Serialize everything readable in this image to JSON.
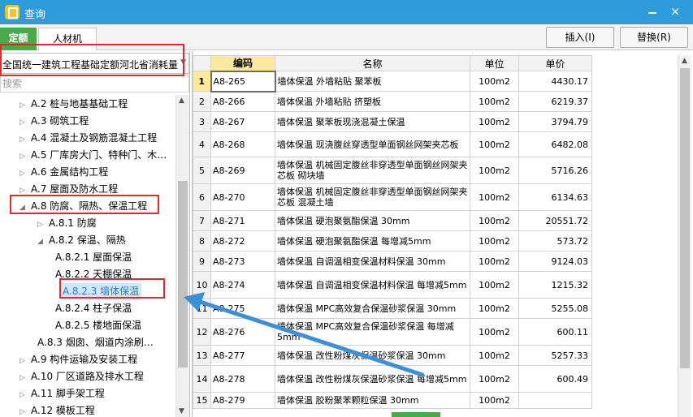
{
  "window": {
    "title": "查询",
    "minimize_glyph": "",
    "close_glyph": "×"
  },
  "tabs": [
    {
      "label": "定额",
      "active": true
    },
    {
      "label": "人材机",
      "active": false
    }
  ],
  "actions": {
    "insert_label": "插入(I)",
    "replace_label": "替换(R)"
  },
  "left": {
    "quota_library": "全国统一建筑工程基础定额河北省消耗量",
    "search_placeholder": "搜索",
    "tree": [
      {
        "label": "A.2 桩与地基基础工程",
        "toggle": "▷"
      },
      {
        "label": "A.3 砌筑工程",
        "toggle": "▷"
      },
      {
        "label": "A.4 混凝土及钢筋混凝土工程",
        "toggle": "▷"
      },
      {
        "label": "A.5 厂库房大门、特种门、木…",
        "toggle": "▷"
      },
      {
        "label": "A.6 金属结构工程",
        "toggle": "▷"
      },
      {
        "label": "A.7 屋面及防水工程",
        "toggle": "▷"
      },
      {
        "label": "A.8 防腐、隔热、保温工程",
        "toggle": "◢"
      },
      {
        "label": "A.8.1 防腐",
        "toggle": "▷"
      },
      {
        "label": "A.8.2 保温、隔热",
        "toggle": "◢"
      },
      {
        "label": "A.8.2.1 屋面保温",
        "toggle": ""
      },
      {
        "label": "A.8.2.2 天棚保温",
        "toggle": ""
      },
      {
        "label": "A.8.2.3 墙体保温",
        "toggle": "",
        "selected": true
      },
      {
        "label": "A.8.2.4 柱子保温",
        "toggle": ""
      },
      {
        "label": "A.8.2.5 楼地面保温",
        "toggle": ""
      },
      {
        "label": "A.8.3 烟囱、烟道内涂刷…",
        "toggle": ""
      },
      {
        "label": "A.9 构件运输及安装工程",
        "toggle": "▷"
      },
      {
        "label": "A.10 厂区道路及排水工程",
        "toggle": "▷"
      },
      {
        "label": "A.11 脚手架工程",
        "toggle": "▷"
      },
      {
        "label": "A.12 模板工程",
        "toggle": "▷"
      }
    ]
  },
  "table": {
    "headers": {
      "num": "",
      "code": "编码",
      "name": "名称",
      "unit": "单位",
      "price": "单价"
    },
    "rows": [
      {
        "num": "1",
        "code": "A8-265",
        "name": "墙体保温 外墙粘贴 聚苯板",
        "unit": "100m2",
        "price": "4430.17"
      },
      {
        "num": "2",
        "code": "A8-266",
        "name": "墙体保温 外墙粘贴 挤塑板",
        "unit": "100m2",
        "price": "6219.37"
      },
      {
        "num": "3",
        "code": "A8-267",
        "name": "墙体保温 聚苯板现浇混凝土保温",
        "unit": "100m2",
        "price": "3794.79"
      },
      {
        "num": "4",
        "code": "A8-268",
        "name": "墙体保温 现浇腹丝穿透型单面钢丝网架夹芯板",
        "unit": "100m2",
        "price": "6482.08"
      },
      {
        "num": "5",
        "code": "A8-269",
        "name": "墙体保温 机械固定腹丝非穿透型单面钢丝网架夹芯板 砌块墙",
        "unit": "100m2",
        "price": "5716.26"
      },
      {
        "num": "6",
        "code": "A8-270",
        "name": "墙体保温 机械固定腹丝非穿透型单面钢丝网架夹芯板 混凝土墙",
        "unit": "100m2",
        "price": "6134.63"
      },
      {
        "num": "7",
        "code": "A8-271",
        "name": "墙体保温 硬泡聚氨酯保温 30mm",
        "unit": "100m2",
        "price": "20551.72"
      },
      {
        "num": "8",
        "code": "A8-272",
        "name": "墙体保温 硬泡聚氨酯保温 每增减5mm",
        "unit": "100m2",
        "price": "573.72"
      },
      {
        "num": "9",
        "code": "A8-273",
        "name": "墙体保温 自调温相变保温材料保温 30mm",
        "unit": "100m2",
        "price": "9124.03"
      },
      {
        "num": "10",
        "code": "A8-274",
        "name": "墙体保温 自调温相变保温材料保温 每增减5mm",
        "unit": "100m2",
        "price": "1215.32"
      },
      {
        "num": "11",
        "code": "A8-275",
        "name": "墙体保温 MPC高效复合保温砂浆保温 30mm",
        "unit": "100m2",
        "price": "5255.08"
      },
      {
        "num": "12",
        "code": "A8-276",
        "name": "墙体保温 MPC高效复合保温砂浆保温 每增减5mm",
        "unit": "100m2",
        "price": "600.11"
      },
      {
        "num": "13",
        "code": "A8-277",
        "name": "墙体保温 改性粉煤灰保温砂浆保温 30mm",
        "unit": "100m2",
        "price": "5257.33"
      },
      {
        "num": "14",
        "code": "A8-278",
        "name": "墙体保温 改性粉煤灰保温砂浆保温 每增减5mm",
        "unit": "100m2",
        "price": "600.49"
      },
      {
        "num": "15",
        "code": "A8-279",
        "name": "墙体保温 胶粉聚苯颗粒保温 30mm",
        "unit": "100m2",
        "price": ""
      }
    ]
  },
  "colors": {
    "titlebar": "#2e9bdd",
    "active_tab": "#4aaa4a",
    "annotation_red": "#e02b2b",
    "annotation_arrow": "#3d8fd8",
    "header_highlight": "#fde89b"
  }
}
